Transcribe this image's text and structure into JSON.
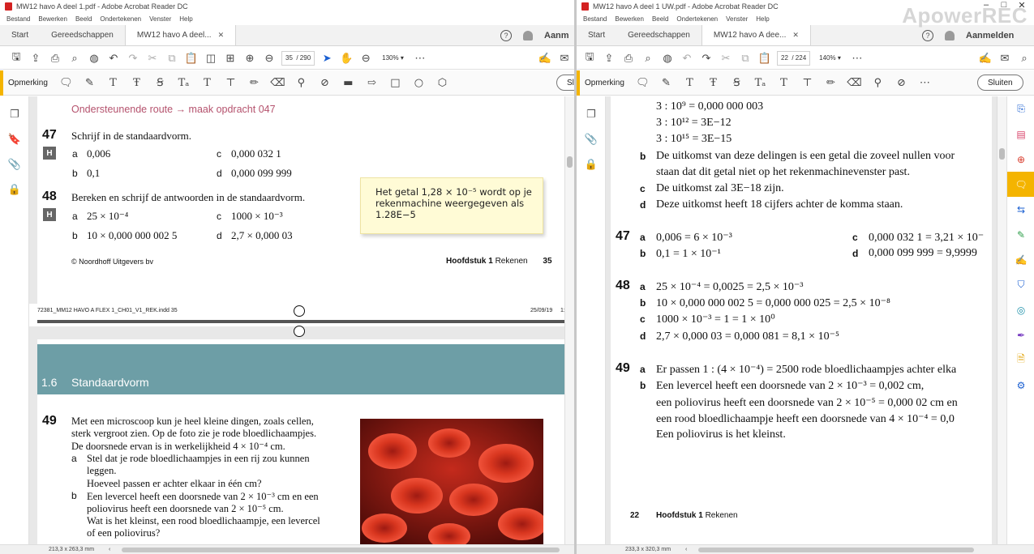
{
  "left": {
    "title": "MW12 havo A deel 1.pdf - Adobe Acrobat Reader DC",
    "menu": [
      "Bestand",
      "Bewerken",
      "Beeld",
      "Ondertekenen",
      "Venster",
      "Help"
    ],
    "tabs": {
      "start": "Start",
      "tools": "Gereedschappen",
      "doc": "MW12 havo A deel...",
      "user": "Aanm"
    },
    "page_current": "35",
    "page_total": "/ 290",
    "zoom": "130%",
    "anno_label": "Opmerking",
    "close_label": "Sl",
    "page1": {
      "route": "Ondersteunende route → maak opdracht 047",
      "q47_num": "47",
      "q47_text": "Schrijf in de standaardvorm.",
      "h": "H",
      "q47a": "0,006",
      "q47b": "0,1",
      "q47c": "0,000 032 1",
      "q47d": "0,000 099 999",
      "q48_num": "48",
      "q48_text": "Bereken en schrijf de antwoorden in de standaardvorm.",
      "q48a": "25 × 10⁻⁴",
      "q48b": "10 × 0,000 000 002 5",
      "q48c": "1000 × 10⁻³",
      "q48d": "2,7 × 0,000 03",
      "a": "a",
      "b": "b",
      "c": "c",
      "d": "d",
      "footer_left": "© Noordhoff Uitgevers bv",
      "footer_chapter": "Hoofdstuk",
      "footer_num": "1",
      "footer_word": "Rekenen",
      "footer_page": "35",
      "print_left": "72381_MM12 HAVO A FLEX 1_CH01_V1_REK.indd   35",
      "print_date": "25/09/19",
      "print_end": "1:"
    },
    "sticky": "Het getal 1,28 × 10⁻⁵ wordt op je\nrekenmachine weergegeven als\n1.28E−5",
    "page2": {
      "section": "1.6",
      "section_title": "Standaardvorm",
      "q49_num": "49",
      "intro": [
        "Met een microscoop kun je heel kleine dingen, zoals cellen,",
        "sterk vergroot zien. Op de foto zie je rode bloedlichaampjes.",
        "De doorsnede ervan is in werkelijkheid 4 × 10⁻⁴ cm."
      ],
      "qa": [
        "Stel dat je rode bloedlichaampjes in een rij zou kunnen",
        "leggen.",
        "Hoeveel passen er achter elkaar in één cm?"
      ],
      "qb": [
        "Een levercel heeft een doorsnede van 2 × 10⁻³ cm en een",
        "poliovirus heeft een doorsnede van 2 × 10⁻⁵ cm.",
        "Wat is het kleinst, een rood bloedlichaampje, een levercel",
        "of een poliovirus?"
      ]
    },
    "status": "213,3 x 263,3 mm"
  },
  "right": {
    "title": "MW12 havo A deel 1 UW.pdf - Adobe Acrobat Reader DC",
    "menu": [
      "Bestand",
      "Bewerken",
      "Beeld",
      "Ondertekenen",
      "Venster",
      "Help"
    ],
    "tabs": {
      "start": "Start",
      "tools": "Gereedschappen",
      "doc": "MW12 havo A dee...",
      "user": "Aanmelden"
    },
    "page_current": "22",
    "page_total": "/ 224",
    "zoom": "140%",
    "anno_label": "Opmerking",
    "close_label": "Sluiten",
    "content": {
      "l1": "3 : 10⁹ = 0,000 000 003",
      "l2": "3 : 10¹² = 3E−12",
      "l3": "3 : 10¹⁵ = 3E−15",
      "b": "b",
      "c": "c",
      "d": "d",
      "a": "a",
      "b_text1": "De uitkomst van deze delingen is een getal die zoveel nullen voor",
      "b_text2": "staan dat dit getal niet op het rekenmachinevenster past.",
      "c_text": "De uitkomst zal 3E−18 zijn.",
      "d_text": "Deze uitkomst heeft 18 cijfers achter de komma staan.",
      "n47": "47",
      "a47a": "0,006 = 6 × 10⁻³",
      "a47b": "0,1 = 1 × 10⁻¹",
      "a47c": "0,000 032 1 = 3,21 × 10⁻",
      "a47d": "0,000 099 999 = 9,9999",
      "n48": "48",
      "a48a": "25 × 10⁻⁴ = 0,0025 = 2,5 × 10⁻³",
      "a48b": "10 × 0,000 000 002 5 = 0,000 000 025 = 2,5 × 10⁻⁸",
      "a48c": "1000 × 10⁻³ = 1 = 1 × 10⁰",
      "a48d": "2,7 × 0,000 03 = 0,000 081 = 8,1 × 10⁻⁵",
      "n49": "49",
      "a49a": "Er passen 1 : (4 × 10⁻⁴) = 2500 rode bloedlichaampjes achter elka",
      "a49b1": "Een levercel heeft een doorsnede van 2 × 10⁻³ = 0,002 cm,",
      "a49b2": "een poliovirus heeft een doorsnede van 2 × 10⁻⁵ = 0,000 02 cm en",
      "a49b3": "een rood bloedlichaampje heeft een doorsnede van 4 × 10⁻⁴ = 0,0",
      "a49b4": "Een poliovirus is het kleinst.",
      "footer_page": "22",
      "footer_chapter": "Hoofdstuk",
      "footer_num": "1",
      "footer_word": "Rekenen"
    },
    "status": "233,3 x 320,3 mm"
  },
  "watermark": "ApowerREC",
  "colors": {
    "accent": "#f4b400",
    "route": "#b5536e",
    "section_band": "#6d9ea6",
    "sticky": "#fffbd6"
  }
}
